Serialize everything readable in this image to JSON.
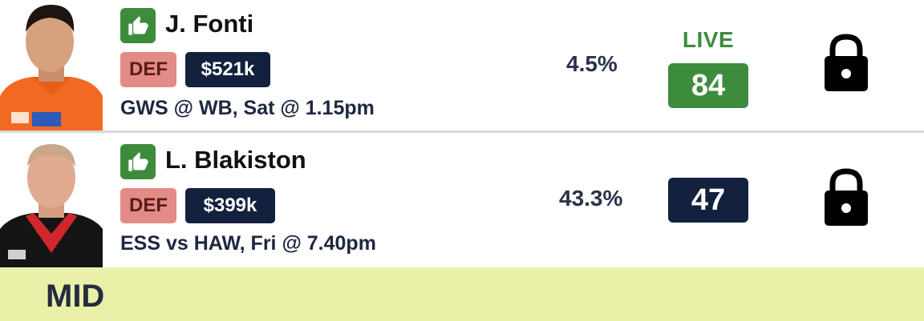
{
  "players": [
    {
      "name": "J. Fonti",
      "position": "DEF",
      "price": "$521k",
      "fixture": "GWS @ WB, Sat @ 1.15pm",
      "owned": "4.5%",
      "status": "LIVE",
      "score": "84",
      "score_color": "#3d8c3d",
      "icons": [
        "thumbs-up-icon",
        "lock-icon"
      ]
    },
    {
      "name": "L. Blakiston",
      "position": "DEF",
      "price": "$399k",
      "fixture": "ESS vs HAW, Fri @ 7.40pm",
      "owned": "43.3%",
      "score": "47",
      "score_color": "#13213e",
      "icons": [
        "thumbs-up-icon",
        "lock-icon"
      ]
    }
  ],
  "section": {
    "title": "MID"
  },
  "colors": {
    "live_green": "#3d8c3d",
    "navy": "#13213e",
    "def_badge": "#e38b86",
    "section_bg": "#eaf0a8"
  }
}
